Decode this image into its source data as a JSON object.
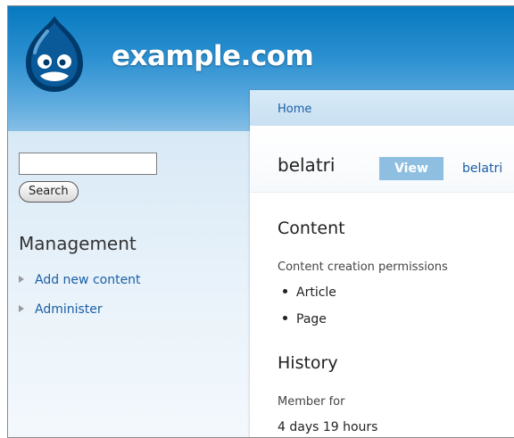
{
  "site": {
    "name": "example.com",
    "logo_icon": "drupal-drop-logo-icon"
  },
  "sidebar": {
    "search_placeholder": "",
    "search_button": "Search",
    "management_title": "Management",
    "items": [
      {
        "label": "Add new content",
        "icon": "triangle-right-icon"
      },
      {
        "label": "Administer",
        "icon": "triangle-right-icon"
      }
    ]
  },
  "main": {
    "breadcrumb": "Home",
    "title": "belatri",
    "tabs": [
      {
        "label": "View",
        "active": true
      },
      {
        "label": "belatri",
        "active": false
      }
    ],
    "content_section": {
      "title": "Content",
      "label": "Content creation permissions",
      "items": [
        "Article",
        "Page"
      ]
    },
    "history_section": {
      "title": "History",
      "label": "Member for",
      "value": "4 days 19 hours"
    }
  },
  "colors": {
    "header_top": "#0779bf",
    "header_bottom": "#86bfe6",
    "link": "#1b5ea5",
    "active_tab": "#8fbfe0",
    "sidebar_bg": "#e4f0f9"
  }
}
